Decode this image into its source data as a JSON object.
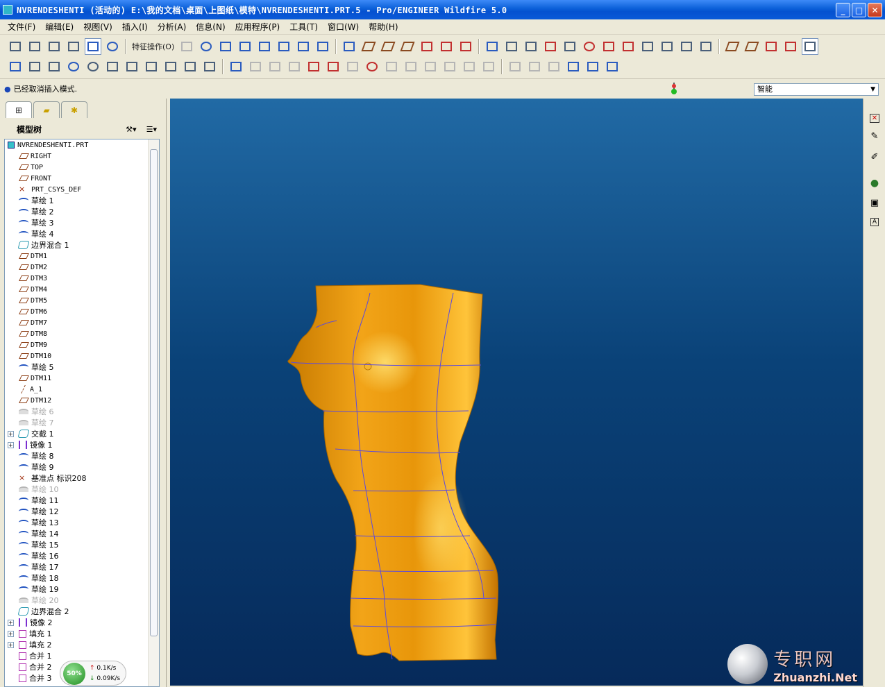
{
  "window": {
    "title": "NVRENDESHENTI (活动的) E:\\我的文档\\桌面\\上图纸\\模特\\NVRENDESHENTI.PRT.5 - Pro/ENGINEER Wildfire 5.0"
  },
  "menu": [
    "文件(F)",
    "编辑(E)",
    "视图(V)",
    "插入(I)",
    "分析(A)",
    "信息(N)",
    "应用程序(P)",
    "工具(T)",
    "窗口(W)",
    "帮助(H)"
  ],
  "toolbar": {
    "feature_ops_label": "特征操作(O)"
  },
  "message": "已经取消插入模式.",
  "filter": {
    "selected": "智能"
  },
  "navigator": {
    "tree_label": "模型树"
  },
  "tree": [
    {
      "label": "NVRENDESHENTI.PRT",
      "icon": "part-icon",
      "mono": true,
      "indent": 0
    },
    {
      "label": "RIGHT",
      "icon": "datum-plane-icon",
      "mono": true,
      "indent": 1
    },
    {
      "label": "TOP",
      "icon": "datum-plane-icon",
      "mono": true,
      "indent": 1
    },
    {
      "label": "FRONT",
      "icon": "datum-plane-icon",
      "mono": true,
      "indent": 1
    },
    {
      "label": "PRT_CSYS_DEF",
      "icon": "csys-icon",
      "mono": true,
      "indent": 1
    },
    {
      "label": "草绘 1",
      "icon": "sketch-icon",
      "indent": 1
    },
    {
      "label": "草绘 2",
      "icon": "sketch-icon",
      "indent": 1
    },
    {
      "label": "草绘 3",
      "icon": "sketch-icon",
      "indent": 1
    },
    {
      "label": "草绘 4",
      "icon": "sketch-icon",
      "indent": 1
    },
    {
      "label": "边界混合 1",
      "icon": "boundary-blend-icon",
      "indent": 1
    },
    {
      "label": "DTM1",
      "icon": "datum-plane-icon",
      "mono": true,
      "indent": 1
    },
    {
      "label": "DTM2",
      "icon": "datum-plane-icon",
      "mono": true,
      "indent": 1
    },
    {
      "label": "DTM3",
      "icon": "datum-plane-icon",
      "mono": true,
      "indent": 1
    },
    {
      "label": "DTM4",
      "icon": "datum-plane-icon",
      "mono": true,
      "indent": 1
    },
    {
      "label": "DTM5",
      "icon": "datum-plane-icon",
      "mono": true,
      "indent": 1
    },
    {
      "label": "DTM6",
      "icon": "datum-plane-icon",
      "mono": true,
      "indent": 1
    },
    {
      "label": "DTM7",
      "icon": "datum-plane-icon",
      "mono": true,
      "indent": 1
    },
    {
      "label": "DTM8",
      "icon": "datum-plane-icon",
      "mono": true,
      "indent": 1
    },
    {
      "label": "DTM9",
      "icon": "datum-plane-icon",
      "mono": true,
      "indent": 1
    },
    {
      "label": "DTM10",
      "icon": "datum-plane-icon",
      "mono": true,
      "indent": 1
    },
    {
      "label": "草绘 5",
      "icon": "sketch-icon",
      "indent": 1
    },
    {
      "label": "DTM11",
      "icon": "datum-plane-icon",
      "mono": true,
      "indent": 1
    },
    {
      "label": "A_1",
      "icon": "datum-axis-icon",
      "mono": true,
      "indent": 1
    },
    {
      "label": "DTM12",
      "icon": "datum-plane-icon",
      "mono": true,
      "indent": 1
    },
    {
      "label": "草绘 6",
      "icon": "sketch-icon",
      "disabled": true,
      "indent": 1
    },
    {
      "label": "草绘 7",
      "icon": "sketch-icon",
      "disabled": true,
      "indent": 1
    },
    {
      "label": "交截 1",
      "icon": "intersect-icon",
      "expand": true,
      "indent": 1
    },
    {
      "label": "镜像 1",
      "icon": "mirror-icon",
      "expand": true,
      "indent": 1
    },
    {
      "label": "草绘 8",
      "icon": "sketch-icon",
      "indent": 1
    },
    {
      "label": "草绘 9",
      "icon": "sketch-icon",
      "indent": 1
    },
    {
      "label": "基准点 标识208",
      "icon": "datum-point-icon",
      "indent": 1
    },
    {
      "label": "草绘 10",
      "icon": "sketch-icon",
      "disabled": true,
      "indent": 1
    },
    {
      "label": "草绘 11",
      "icon": "sketch-icon",
      "indent": 1
    },
    {
      "label": "草绘 12",
      "icon": "sketch-icon",
      "indent": 1
    },
    {
      "label": "草绘 13",
      "icon": "sketch-icon",
      "indent": 1
    },
    {
      "label": "草绘 14",
      "icon": "sketch-icon",
      "indent": 1
    },
    {
      "label": "草绘 15",
      "icon": "sketch-icon",
      "indent": 1
    },
    {
      "label": "草绘 16",
      "icon": "sketch-icon",
      "indent": 1
    },
    {
      "label": "草绘 17",
      "icon": "sketch-icon",
      "indent": 1
    },
    {
      "label": "草绘 18",
      "icon": "sketch-icon",
      "indent": 1
    },
    {
      "label": "草绘 19",
      "icon": "sketch-icon",
      "indent": 1
    },
    {
      "label": "草绘 20",
      "icon": "sketch-icon",
      "disabled": true,
      "indent": 1
    },
    {
      "label": "边界混合 2",
      "icon": "boundary-blend-icon",
      "indent": 1
    },
    {
      "label": "镜像 2",
      "icon": "mirror-icon",
      "expand": true,
      "indent": 1
    },
    {
      "label": "填充 1",
      "icon": "fill-icon",
      "expand": true,
      "indent": 1
    },
    {
      "label": "填充 2",
      "icon": "fill-icon",
      "expand": true,
      "indent": 1
    },
    {
      "label": "合并 1",
      "icon": "merge-icon",
      "indent": 1
    },
    {
      "label": "合并 2",
      "icon": "merge-icon",
      "indent": 1
    },
    {
      "label": "合并 3",
      "icon": "merge-icon",
      "indent": 1
    }
  ],
  "net": {
    "percent": "50%",
    "up": "0.1K/s",
    "down": "0.09K/s"
  },
  "watermark": {
    "cn": "专职网",
    "en": "Zhuanzhi.Net"
  },
  "colors": {
    "model": "#e0940a",
    "viewport_top": "#216aa5",
    "viewport_bottom": "#062a5a",
    "curve": "#5a4adf"
  }
}
